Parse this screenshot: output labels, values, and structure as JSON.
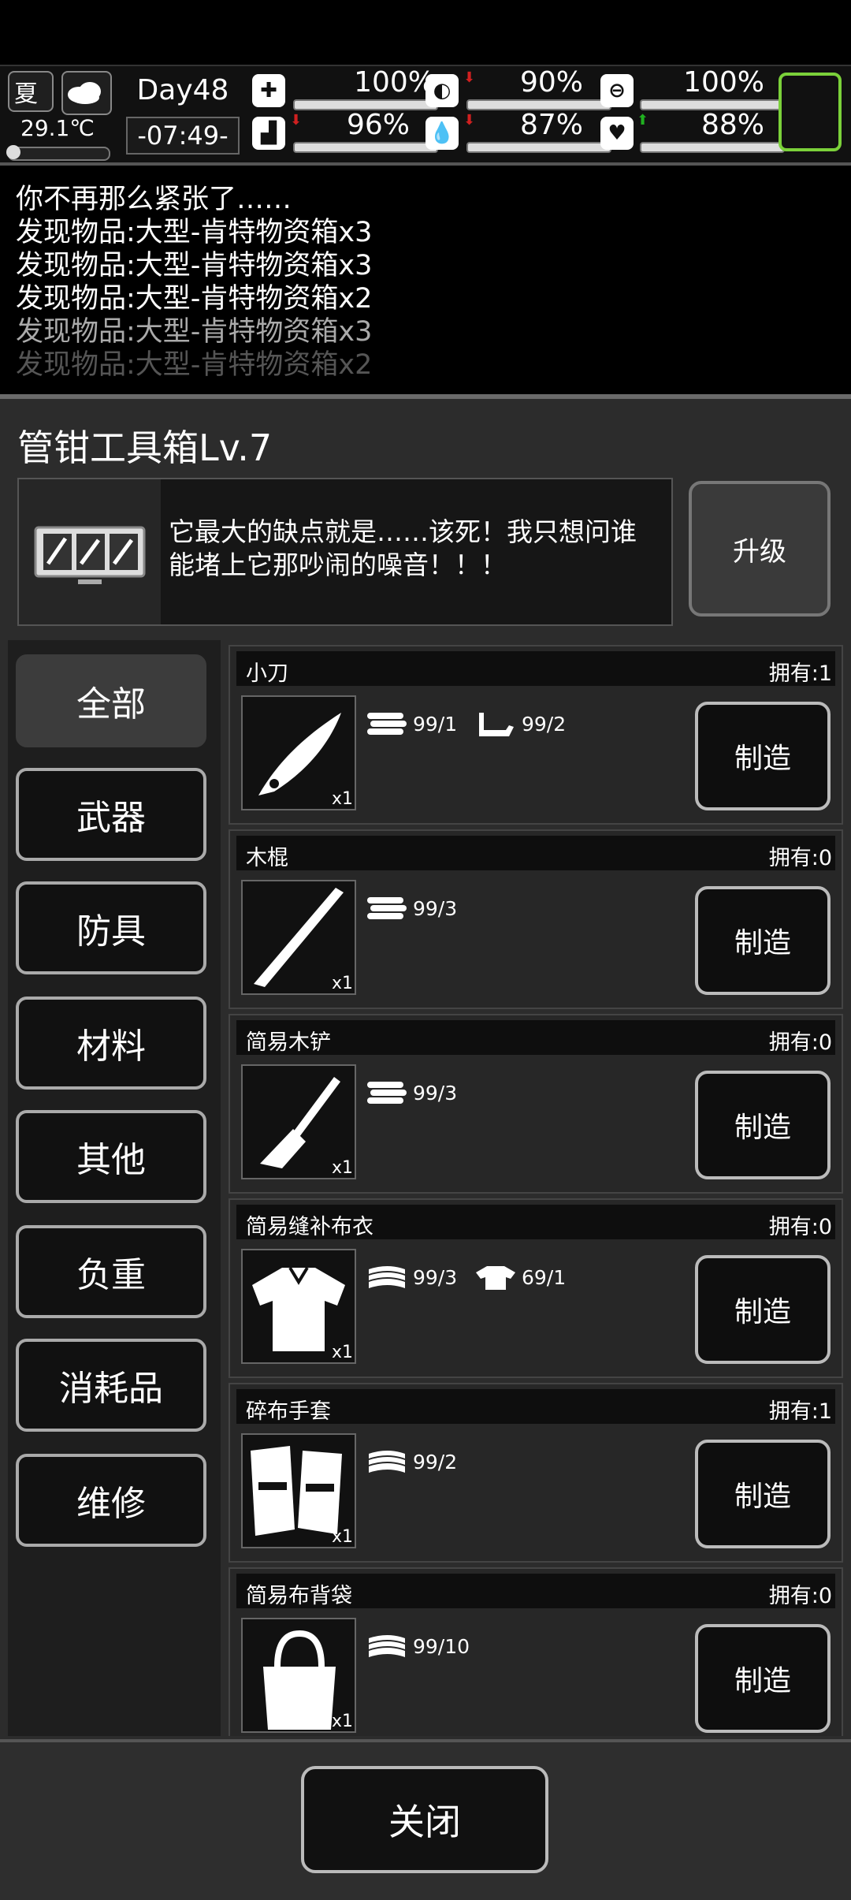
{
  "status": {
    "season": "夏",
    "temperature": "29.1℃",
    "day": "Day48",
    "time": "-07:49-",
    "stats": [
      {
        "icon": "medkit-icon",
        "pct": "100%",
        "fill": 1.0,
        "trend": ""
      },
      {
        "icon": "stomach-icon",
        "pct": "90%",
        "fill": 0.9,
        "trend": "down"
      },
      {
        "icon": "sanity-icon",
        "pct": "100%",
        "fill": 1.0,
        "trend": ""
      },
      {
        "icon": "boot-icon",
        "pct": "96%",
        "fill": 0.96,
        "trend": "down"
      },
      {
        "icon": "water-drop-icon",
        "pct": "87%",
        "fill": 0.87,
        "trend": "down"
      },
      {
        "icon": "heart-icon",
        "pct": "88%",
        "fill": 0.88,
        "trend": "up"
      }
    ]
  },
  "log": [
    "你不再那么紧张了……",
    "发现物品:大型-肯特物资箱x3",
    "发现物品:大型-肯特物资箱x3",
    "发现物品:大型-肯特物资箱x2",
    "发现物品:大型-肯特物资箱x3",
    "发现物品:大型-肯特物资箱x2"
  ],
  "panel": {
    "title": "管钳工具箱Lv.7",
    "description": "它最大的缺点就是……该死！我只想问谁能堵上它那吵闹的噪音！！！",
    "upgrade_label": "升级"
  },
  "categories": [
    "全部",
    "武器",
    "防具",
    "材料",
    "其他",
    "负重",
    "消耗品",
    "维修"
  ],
  "items": [
    {
      "name": "小刀",
      "owned": "拥有:1",
      "qty": "x1",
      "mats": [
        {
          "icon": "wood-logs-icon",
          "text": "99/1"
        },
        {
          "icon": "pipe-icon",
          "text": "99/2"
        }
      ],
      "make": "制造"
    },
    {
      "name": "木棍",
      "owned": "拥有:0",
      "qty": "x1",
      "mats": [
        {
          "icon": "wood-logs-icon",
          "text": "99/3"
        }
      ],
      "make": "制造"
    },
    {
      "name": "简易木铲",
      "owned": "拥有:0",
      "qty": "x1",
      "mats": [
        {
          "icon": "wood-logs-icon",
          "text": "99/3"
        }
      ],
      "make": "制造"
    },
    {
      "name": "简易缝补布衣",
      "owned": "拥有:0",
      "qty": "x1",
      "mats": [
        {
          "icon": "cloth-icon",
          "text": "99/3"
        },
        {
          "icon": "rag-shirt-icon",
          "text": "69/1"
        }
      ],
      "make": "制造"
    },
    {
      "name": "碎布手套",
      "owned": "拥有:1",
      "qty": "x1",
      "mats": [
        {
          "icon": "cloth-icon",
          "text": "99/2"
        }
      ],
      "make": "制造"
    },
    {
      "name": "简易布背袋",
      "owned": "拥有:0",
      "qty": "x1",
      "mats": [
        {
          "icon": "cloth-icon",
          "text": "99/10"
        }
      ],
      "make": "制造"
    }
  ],
  "close_label": "关闭"
}
